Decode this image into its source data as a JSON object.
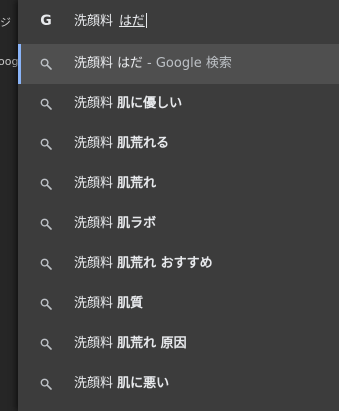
{
  "background": {
    "snippet_top": "ジ",
    "snippet_mid": "oog"
  },
  "omnibox": {
    "typed_text": "洗顔料",
    "composition_text": "はだ"
  },
  "suggestions": [
    {
      "prefix": "洗顔料",
      "rest": "はだ",
      "suffix": " - Google 検索",
      "selected": true
    },
    {
      "prefix": "洗顔料",
      "rest": "肌に優しい",
      "suffix": ""
    },
    {
      "prefix": "洗顔料",
      "rest": "肌荒れる",
      "suffix": ""
    },
    {
      "prefix": "洗顔料",
      "rest": "肌荒れ",
      "suffix": ""
    },
    {
      "prefix": "洗顔料",
      "rest": "肌ラボ",
      "suffix": ""
    },
    {
      "prefix": "洗顔料",
      "rest": "肌荒れ おすすめ",
      "suffix": ""
    },
    {
      "prefix": "洗顔料",
      "rest": "肌質",
      "suffix": ""
    },
    {
      "prefix": "洗顔料",
      "rest": "肌荒れ 原因",
      "suffix": ""
    },
    {
      "prefix": "洗顔料",
      "rest": "肌に悪い",
      "suffix": ""
    }
  ],
  "icons": {
    "omnibox": "google-g-icon",
    "suggestion": "search-icon"
  }
}
